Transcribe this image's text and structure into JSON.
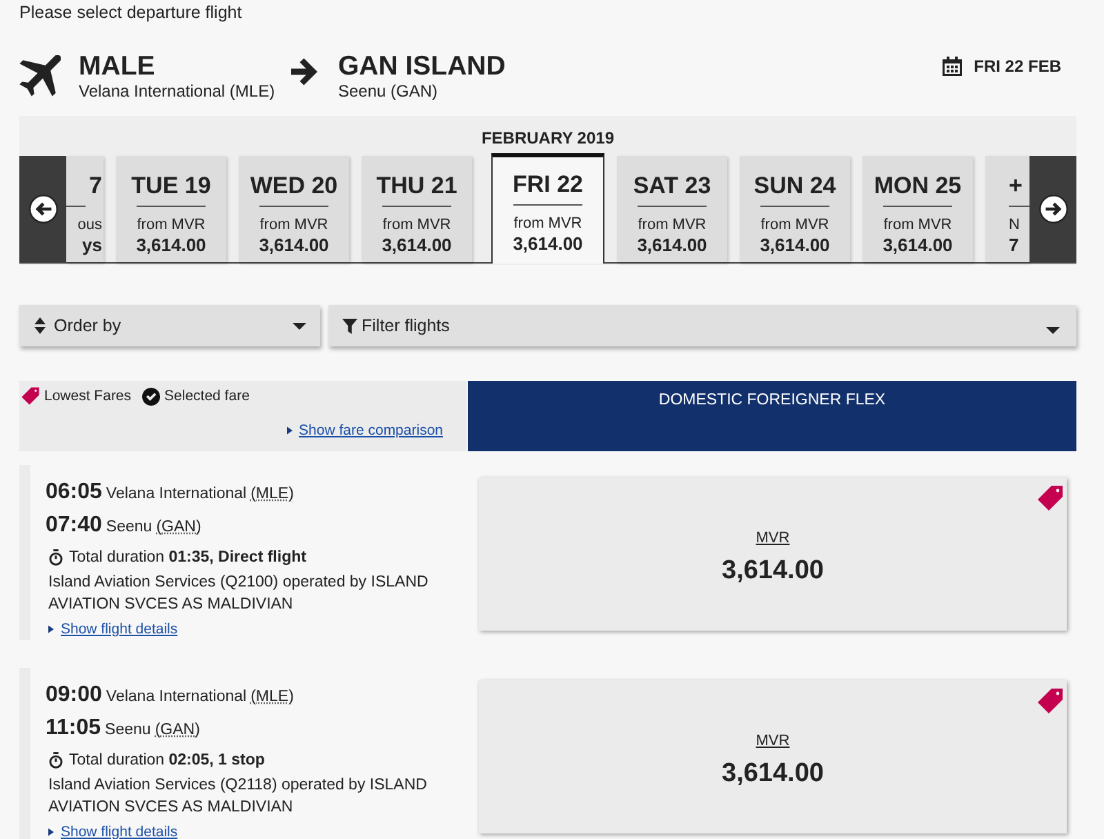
{
  "heading": "Please select departure flight",
  "route": {
    "origin": {
      "city": "MALE",
      "airport": "Velana International (MLE)"
    },
    "destination": {
      "city": "GAN ISLAND",
      "airport": "Seenu (GAN)"
    },
    "date": "FRI 22 FEB"
  },
  "date_carousel": {
    "month": "FEBRUARY 2019",
    "days": [
      {
        "kind": "partial-start",
        "label": "7",
        "prefix": "ous",
        "price": "ys",
        "selected": false
      },
      {
        "kind": "day",
        "label": "TUE 19",
        "prefix": "from MVR",
        "price": "3,614.00",
        "selected": false
      },
      {
        "kind": "day",
        "label": "WED 20",
        "prefix": "from MVR",
        "price": "3,614.00",
        "selected": false
      },
      {
        "kind": "day",
        "label": "THU 21",
        "prefix": "from MVR",
        "price": "3,614.00",
        "selected": false
      },
      {
        "kind": "day",
        "label": "FRI 22",
        "prefix": "from MVR",
        "price": "3,614.00",
        "selected": true
      },
      {
        "kind": "day",
        "label": "SAT 23",
        "prefix": "from MVR",
        "price": "3,614.00",
        "selected": false
      },
      {
        "kind": "day",
        "label": "SUN 24",
        "prefix": "from MVR",
        "price": "3,614.00",
        "selected": false
      },
      {
        "kind": "day",
        "label": "MON 25",
        "prefix": "from MVR",
        "price": "3,614.00",
        "selected": false
      },
      {
        "kind": "partial-end",
        "label": "+",
        "prefix": "N",
        "price": "7",
        "selected": false
      }
    ]
  },
  "order_by": {
    "label": "Order by"
  },
  "filter": {
    "label": "Filter flights"
  },
  "legend": {
    "lowest_fares": "Lowest Fares",
    "selected_fare": "Selected fare",
    "comparison_link": "Show fare comparison"
  },
  "fare_family": "DOMESTIC FOREIGNER FLEX",
  "flights": [
    {
      "departure_time": "06:05",
      "departure_airport": "Velana International",
      "departure_code": "(MLE)",
      "arrival_time": "07:40",
      "arrival_airport": "Seenu",
      "arrival_code": "(GAN)",
      "duration": "Total duration **01:35, Direct flight**",
      "carrier": "Island Aviation Services (Q2100) operated by ISLAND AVIATION SVCES AS MALDIVIAN",
      "details_link": "Show flight details",
      "fare": {
        "currency": "MVR",
        "price": "3,614.00",
        "lowest": true
      }
    },
    {
      "departure_time": "09:00",
      "departure_airport": "Velana International",
      "departure_code": "(MLE)",
      "arrival_time": "11:05",
      "arrival_airport": "Seenu",
      "arrival_code": "(GAN)",
      "duration": "Total duration **02:05, 1 stop**",
      "carrier": "Island Aviation Services (Q2118) operated by ISLAND AVIATION SVCES AS MALDIVIAN",
      "details_link": "Show flight details",
      "fare": {
        "currency": "MVR",
        "price": "3,614.00",
        "lowest": true
      }
    }
  ]
}
